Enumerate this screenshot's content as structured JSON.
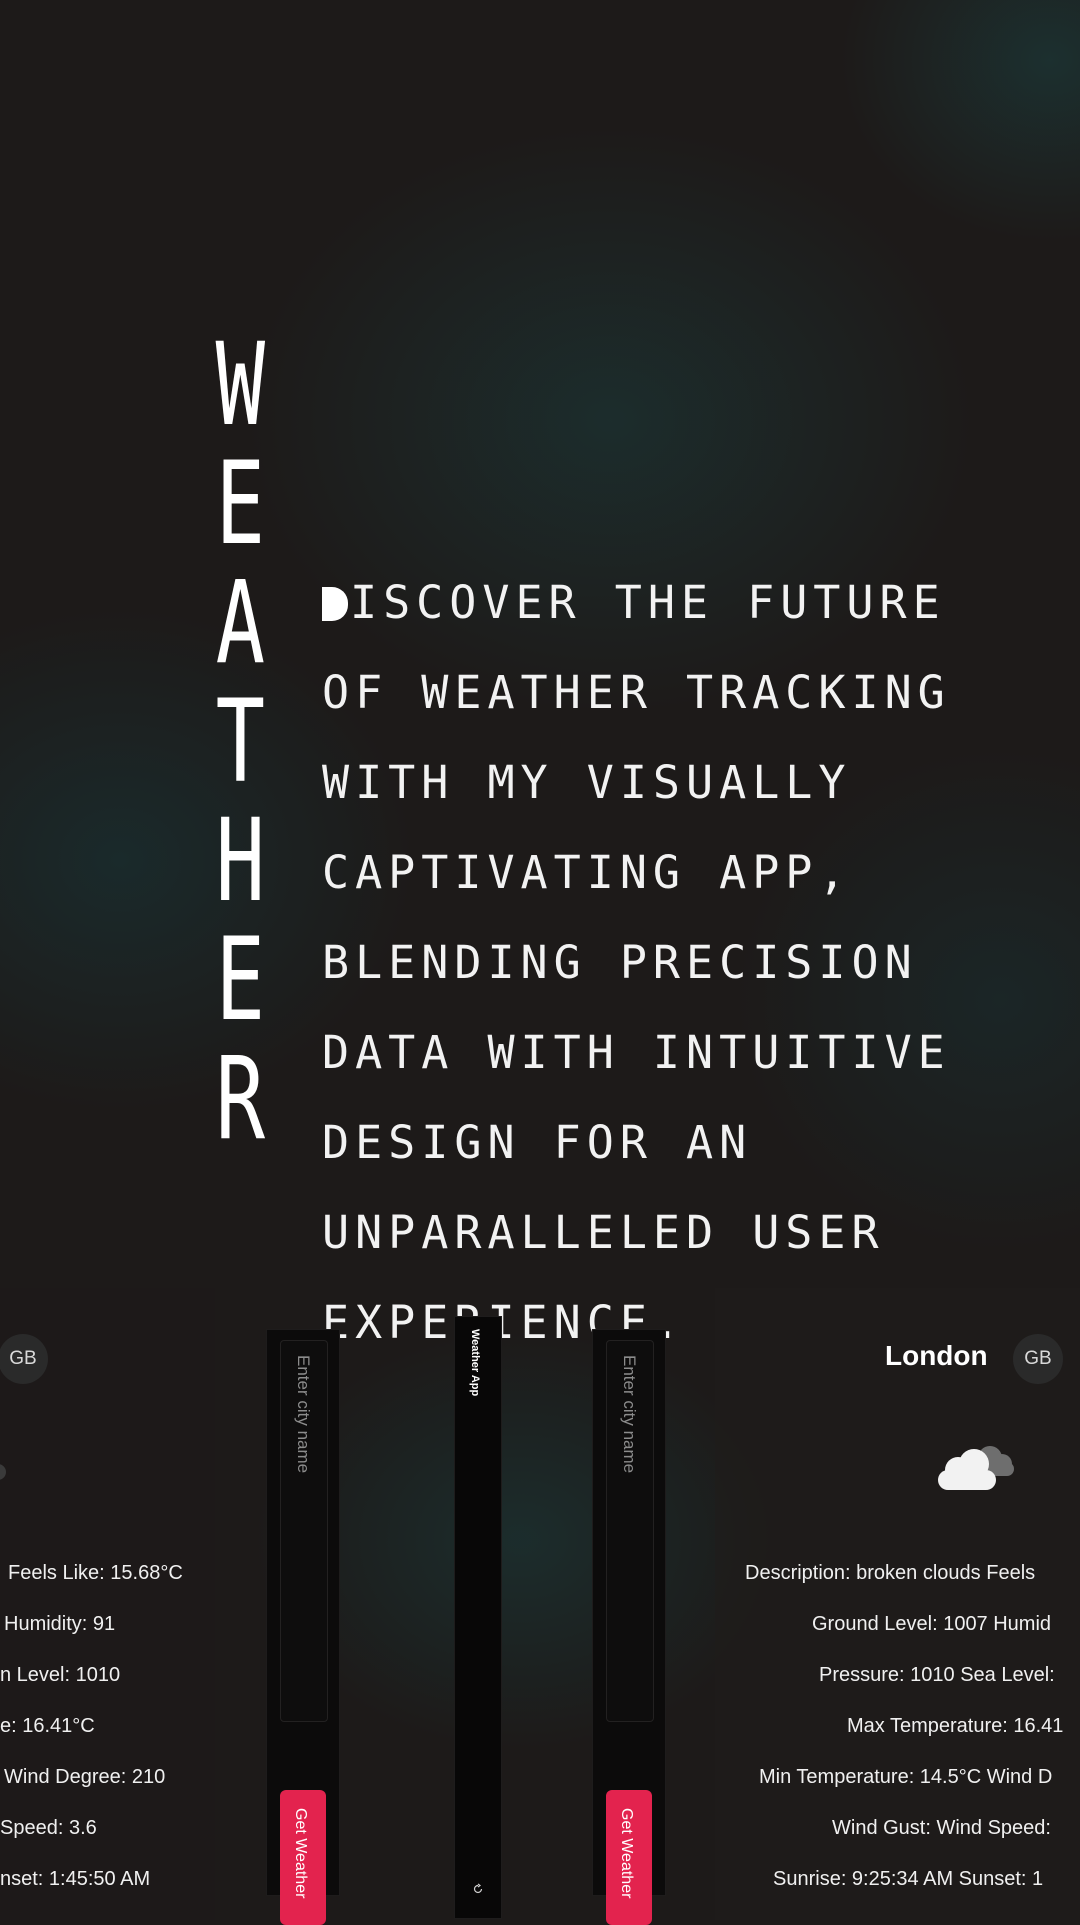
{
  "hero": {
    "vertical_title": [
      "W",
      "E",
      "A",
      "T",
      "H",
      "E",
      "R"
    ],
    "tagline_lines": [
      "ISCOVER THE FUTURE",
      "OF WEATHER TRACKING",
      "WITH MY VISUALLY",
      "CAPTIVATING APP,",
      "BLENDING PRECISION",
      "DATA WITH INTUITIVE",
      "DESIGN FOR AN",
      "UNPARALLELED USER",
      "EXPERIENCE."
    ]
  },
  "left_card": {
    "country": "GB",
    "lines": [
      "Feels Like: 15.68°C",
      "Humidity: 91",
      "n Level: 1010",
      "e: 16.41°C",
      "Wind Degree: 210",
      "Speed: 3.6",
      "nset: 1:45:50 AM"
    ]
  },
  "search_panel_a": {
    "placeholder": "Enter city name",
    "button": "Get Weather"
  },
  "side_app": {
    "title": "Weather App",
    "icon": "refresh-icon"
  },
  "search_panel_b": {
    "placeholder": "Enter city name",
    "button": "Get Weather"
  },
  "right_card": {
    "city": "London",
    "country": "GB",
    "weather_icon": "broken-clouds-icon",
    "lines": [
      "Description: broken clouds   Feels",
      "Ground Level: 1007    Humid",
      "Pressure: 1010    Sea Level:",
      "Max Temperature: 16.41",
      "Min Temperature: 14.5°C    Wind D",
      "Wind Gust:    Wind Speed:",
      "Sunrise: 9:25:34 AM    Sunset: 1"
    ]
  },
  "colors": {
    "accent": "#e3234e",
    "background": "#1d1a19"
  }
}
